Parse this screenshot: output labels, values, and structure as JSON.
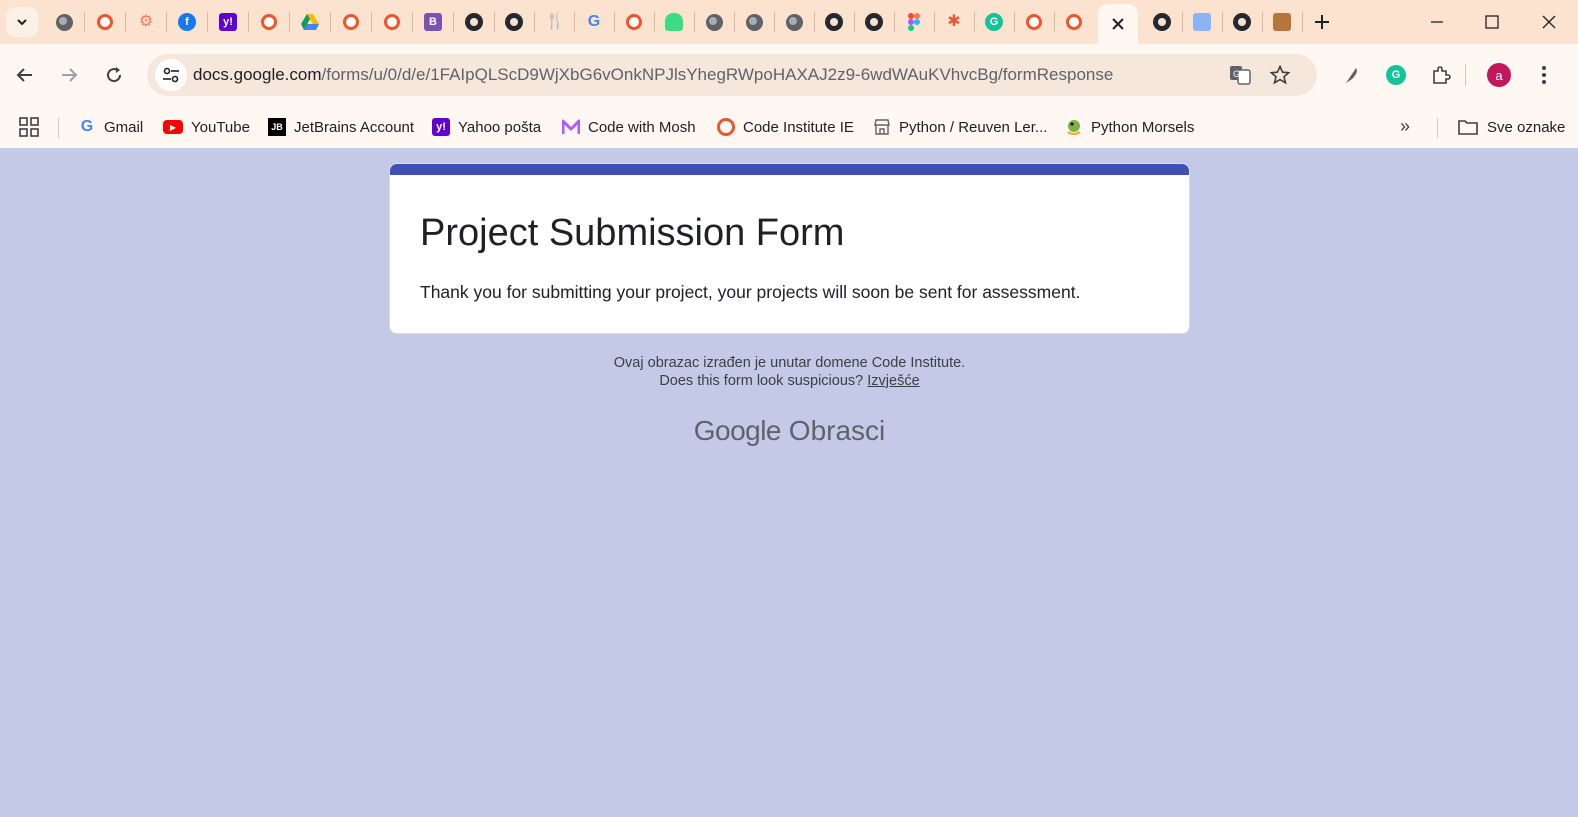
{
  "browser": {
    "tabs": [
      {
        "icon": "globe-icon"
      },
      {
        "icon": "code-institute-icon"
      },
      {
        "icon": "hubspot-icon"
      },
      {
        "icon": "facebook-icon"
      },
      {
        "icon": "yahoo-icon"
      },
      {
        "icon": "code-institute-icon"
      },
      {
        "icon": "google-drive-icon"
      },
      {
        "icon": "code-institute-icon"
      },
      {
        "icon": "code-institute-icon"
      },
      {
        "icon": "bootstrap-icon"
      },
      {
        "icon": "github-icon"
      },
      {
        "icon": "github-icon"
      },
      {
        "icon": "fork-knife-icon"
      },
      {
        "icon": "google-icon"
      },
      {
        "icon": "code-institute-icon"
      },
      {
        "icon": "android-icon"
      },
      {
        "icon": "globe-icon"
      },
      {
        "icon": "globe-icon"
      },
      {
        "icon": "globe-icon"
      },
      {
        "icon": "github-icon"
      },
      {
        "icon": "github-icon"
      },
      {
        "icon": "figma-icon"
      },
      {
        "icon": "asterisk-icon"
      },
      {
        "icon": "grammarly-icon"
      },
      {
        "icon": "code-institute-icon"
      },
      {
        "icon": "code-institute-icon"
      },
      {
        "icon": "close-icon",
        "active": true
      },
      {
        "icon": "github-icon"
      },
      {
        "icon": "image-icon"
      },
      {
        "icon": "github-icon"
      },
      {
        "icon": "chest-icon"
      }
    ],
    "url_host": "docs.google.com",
    "url_path": "/forms/u/0/d/e/1FAIpQLScD9WjXbG6vOnkNPJlsYhegRWpoHAXAJ2z9-6wdWAuKVhvcBg/formResponse",
    "profile_initial": "a"
  },
  "bookmarks": {
    "items": [
      {
        "label": "Gmail",
        "icon": "google-icon"
      },
      {
        "label": "YouTube",
        "icon": "youtube-icon"
      },
      {
        "label": "JetBrains Account",
        "icon": "jetbrains-icon"
      },
      {
        "label": "Yahoo pošta",
        "icon": "yahoo-icon"
      },
      {
        "label": "Code with Mosh",
        "icon": "mosh-icon"
      },
      {
        "label": "Code Institute IE",
        "icon": "code-institute-icon"
      },
      {
        "label": "Python / Reuven Ler...",
        "icon": "store-icon"
      },
      {
        "label": "Python Morsels",
        "icon": "snake-icon"
      }
    ],
    "all_bookmarks": "Sve oznake"
  },
  "form": {
    "title": "Project Submission Form",
    "message": "Thank you for submitting your project, your projects will soon be sent for assessment.",
    "footer_line1": "Ovaj obrazac izrađen je unutar domene Code Institute.",
    "footer_line2": "Does this form look suspicious?",
    "report_link": "Izvješće",
    "brand_google": "Google",
    "brand_forms": "Obrasci"
  },
  "colors": {
    "page_background": "#c5c9e8",
    "form_accent": "#3f51b5",
    "tabstrip": "#fbe3cf"
  }
}
